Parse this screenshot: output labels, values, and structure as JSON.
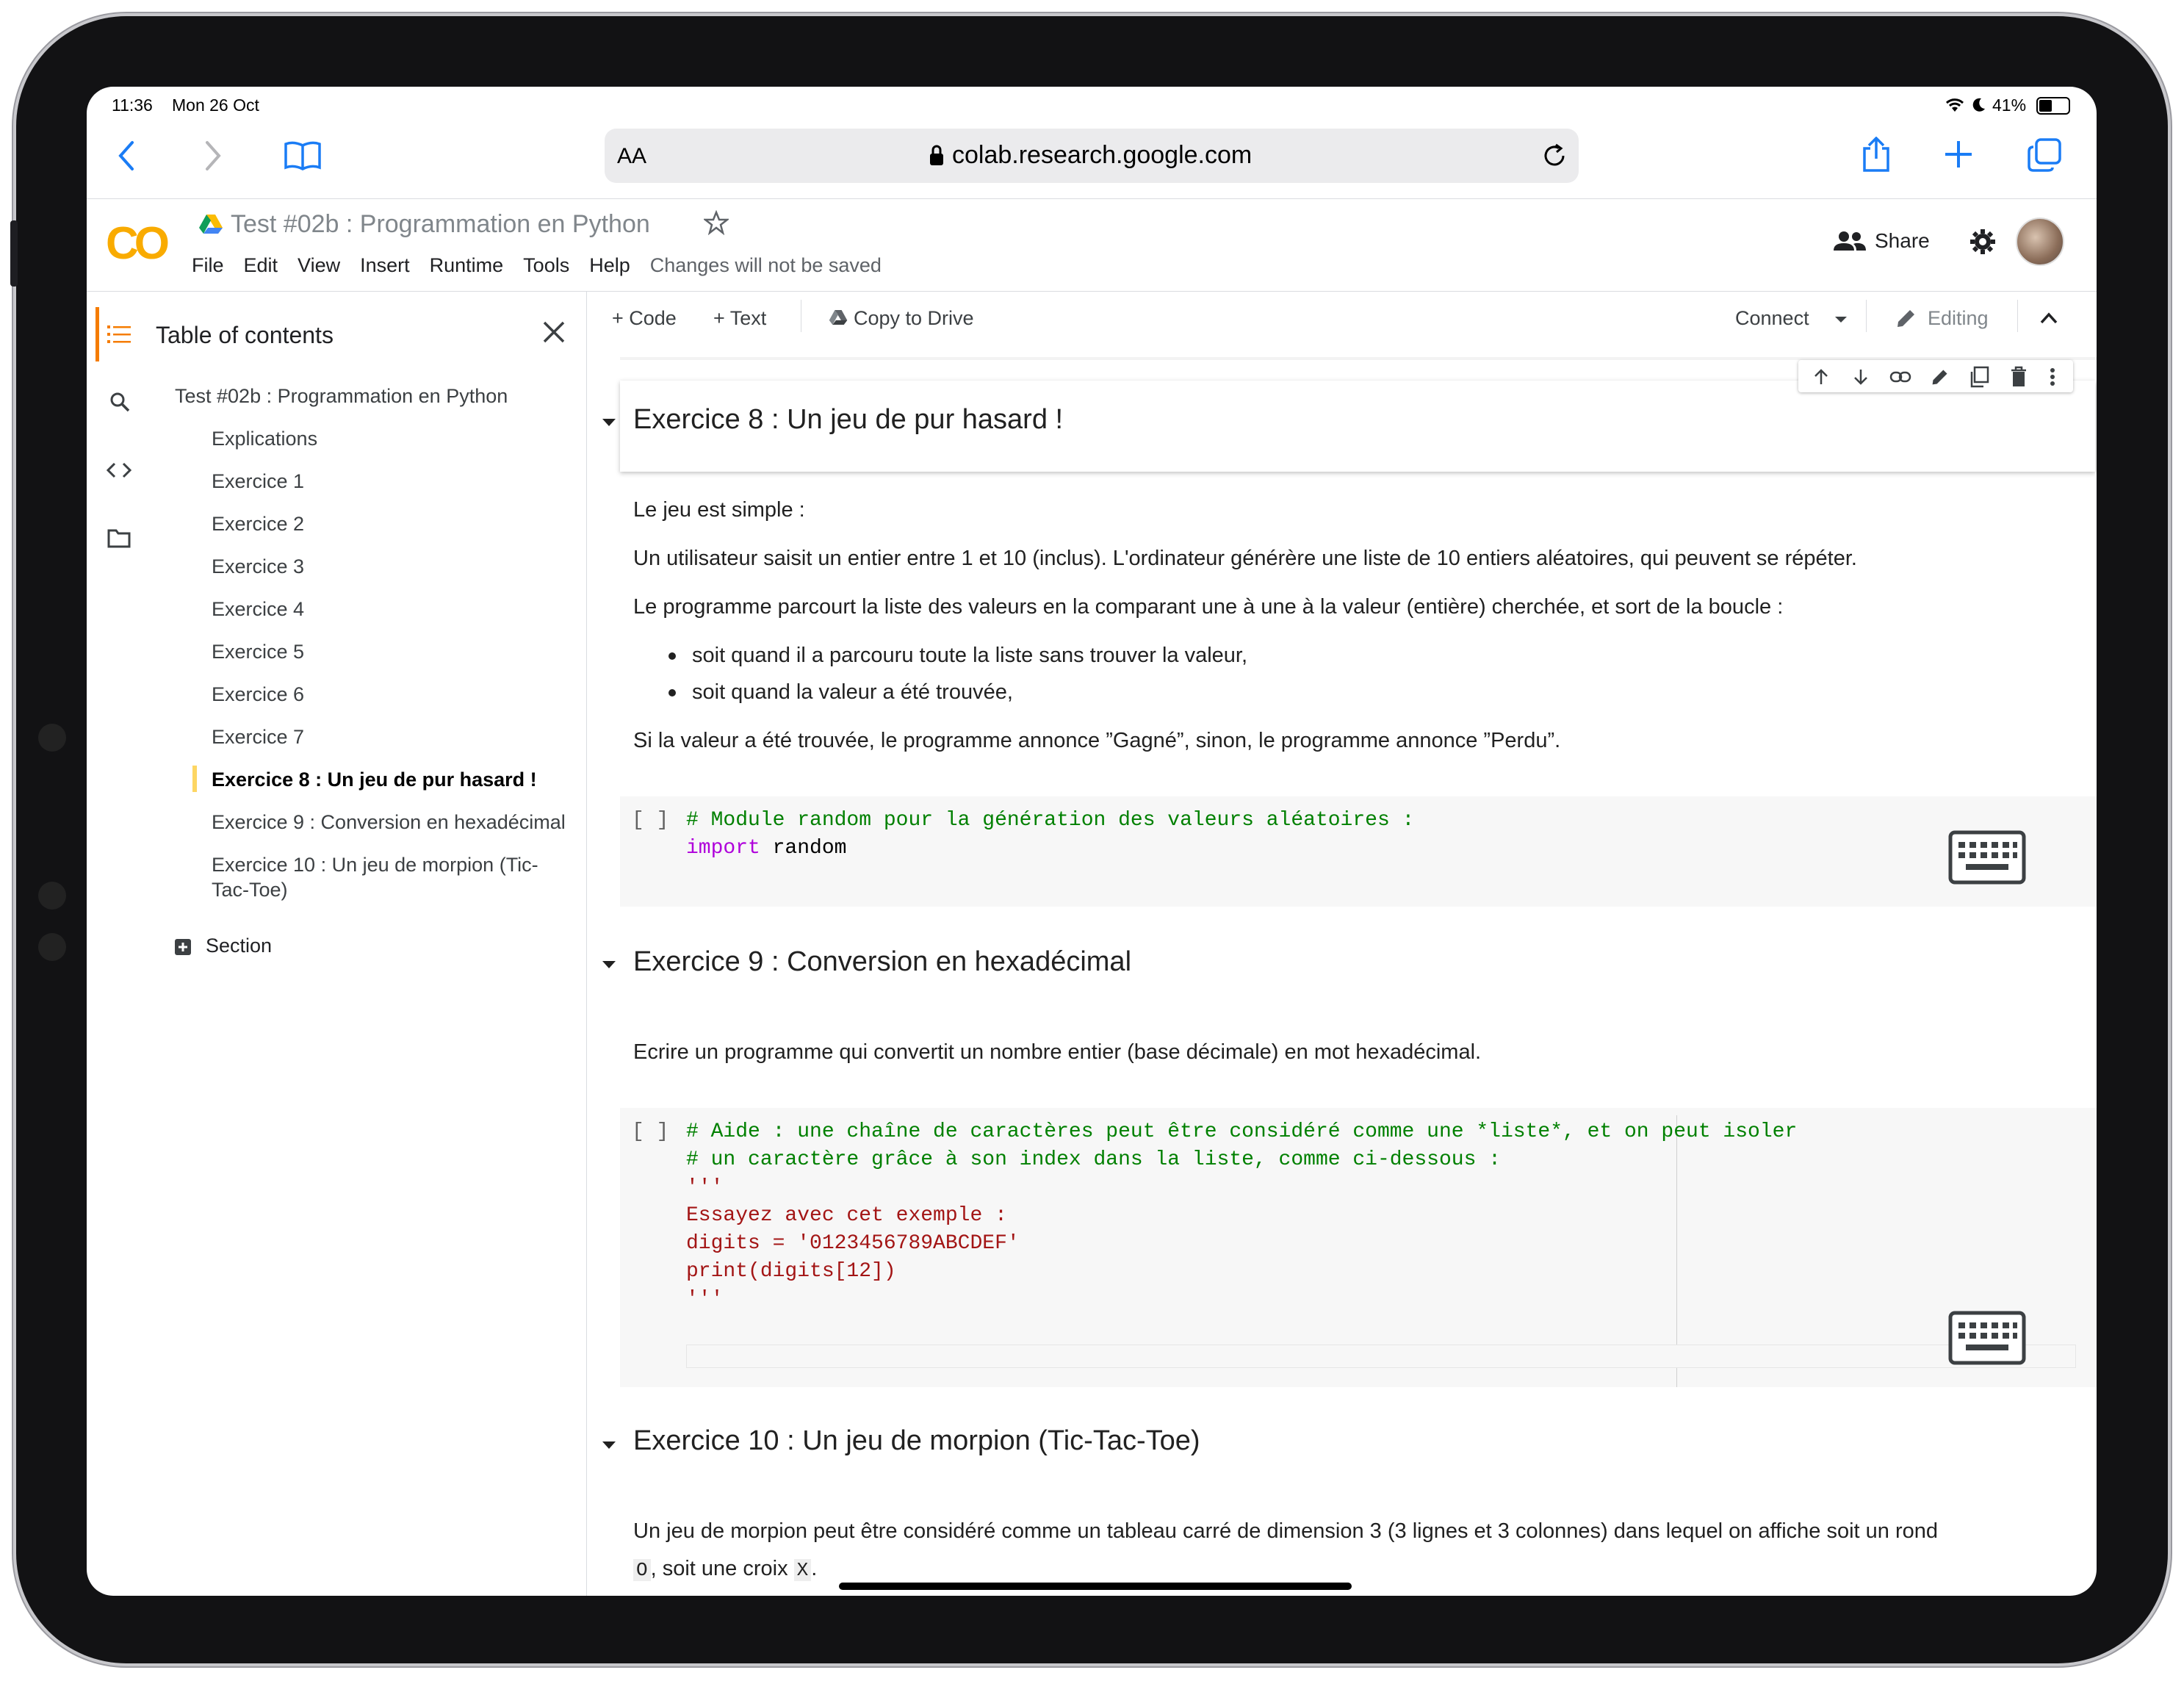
{
  "status_bar": {
    "time": "11:36",
    "date": "Mon 26 Oct",
    "battery": "41%"
  },
  "safari": {
    "text_size_label": "AA",
    "url": "colab.research.google.com",
    "icons": [
      "chevron-back-icon",
      "chevron-forward-icon",
      "bookmarks-icon",
      "lock-icon",
      "reload-icon",
      "share-icon",
      "new-tab-icon",
      "tabs-icon"
    ]
  },
  "colab": {
    "logo": "CO",
    "title": "Test #02b : Programmation en Python",
    "menu": [
      "File",
      "Edit",
      "View",
      "Insert",
      "Runtime",
      "Tools",
      "Help"
    ],
    "changes_notice": "Changes will not be saved",
    "share_label": "Share"
  },
  "toolbar": {
    "code_label": "+ Code",
    "text_label": "+ Text",
    "copy_to_drive": "Copy to Drive",
    "connect": "Connect",
    "editing": "Editing"
  },
  "toc": {
    "title": "Table of contents",
    "root": "Test #02b : Programmation en Python",
    "items": [
      "Explications",
      "Exercice 1",
      "Exercice 2",
      "Exercice 3",
      "Exercice 4",
      "Exercice 5",
      "Exercice 6",
      "Exercice 7",
      "Exercice 8 : Un jeu de pur hasard !",
      "Exercice 9 : Conversion en hexadécimal",
      "Exercice 10 : Un jeu de morpion (Tic-",
      "Tac-Toe)"
    ],
    "section_label": "Section"
  },
  "notebook": {
    "ex8_heading": "Exercice 8 : Un jeu de pur hasard !",
    "ex8_p1": "Le jeu est simple :",
    "ex8_p2": "Un utilisateur saisit un entier entre 1 et 10 (inclus). L'ordinateur générère une liste de 10 entiers aléatoires, qui peuvent se répéter.",
    "ex8_p3": "Le programme parcourt la liste des valeurs en la comparant une à une à la valeur (entière) cherchée, et sort de la boucle :",
    "ex8_b1": "soit quand il a parcouru toute la liste sans trouver la valeur,",
    "ex8_b2": "soit quand la valeur a été trouvée,",
    "ex8_p4": "Si la valeur a été trouvée, le programme annonce ”Gagné”, sinon, le programme annonce ”Perdu”.",
    "cell_bracket": "[ ]",
    "code1_l1": "# Module random pour la génération des valeurs aléatoires :",
    "code1_kw": "import",
    "code1_rest": " random",
    "ex9_heading": "Exercice 9 : Conversion en hexadécimal",
    "ex9_p1": "Ecrire un programme qui convertit un nombre entier (base décimale) en mot hexadécimal.",
    "code2_l1": "# Aide : une chaîne de caractères peut être considéré comme une *liste*, et on peut isoler",
    "code2_l2": "# un caractère grâce à son index dans la liste, comme ci-dessous :",
    "code2_l3": "'''",
    "code2_l4": "Essayez avec cet exemple :",
    "code2_l5": "digits = '0123456789ABCDEF'",
    "code2_l6": "print(digits[12])",
    "code2_l7": "'''",
    "ex10_heading": "Exercice 10 : Un jeu de morpion (Tic-Tac-Toe)",
    "ex10_p1": "Un jeu de morpion peut être considéré comme un tableau carré de dimension 3 (3 lignes et 3 colonnes) dans lequel on affiche soit un rond",
    "ex10_code_o": "O",
    "ex10_mid": ", soit une croix ",
    "ex10_code_x": "X",
    "ex10_end": "."
  },
  "colors": {
    "accent_orange": "#f9ab00",
    "safari_blue": "#1a7cf5",
    "code_green": "#008000",
    "code_red": "#a31515",
    "keyword_purple": "#af00db"
  }
}
